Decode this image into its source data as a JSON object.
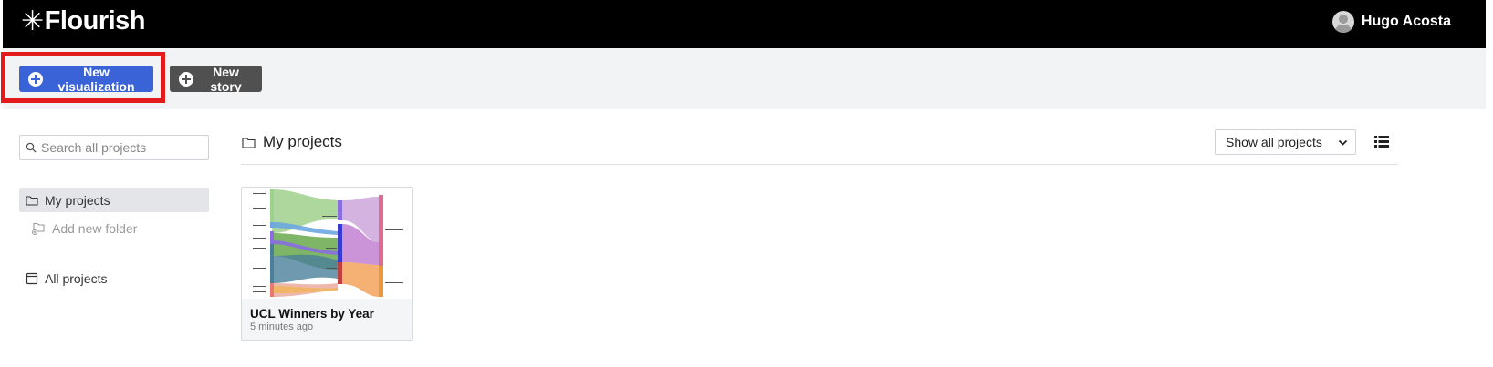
{
  "app": {
    "logo_text": "Flourish",
    "logo_star": "✳",
    "user_name": "Hugo Acosta"
  },
  "toolbar": {
    "new_visualization_label": "New visualization",
    "new_story_label": "New story"
  },
  "sidebar": {
    "search_placeholder": "Search all projects",
    "items": [
      {
        "label": "My projects",
        "icon": "folder-icon"
      },
      {
        "label": "Add new folder",
        "icon": "add-folder-icon"
      },
      {
        "label": "All projects",
        "icon": "box-icon"
      }
    ]
  },
  "main": {
    "title": "My projects",
    "filter_selected": "Show all projects",
    "projects": [
      {
        "title": "UCL Winners by Year",
        "updated": "5 minutes ago"
      }
    ]
  },
  "colors": {
    "primary": "#3b63d8",
    "secondary": "#505050",
    "highlight": "#e31b1b",
    "topbar": "#000000"
  }
}
